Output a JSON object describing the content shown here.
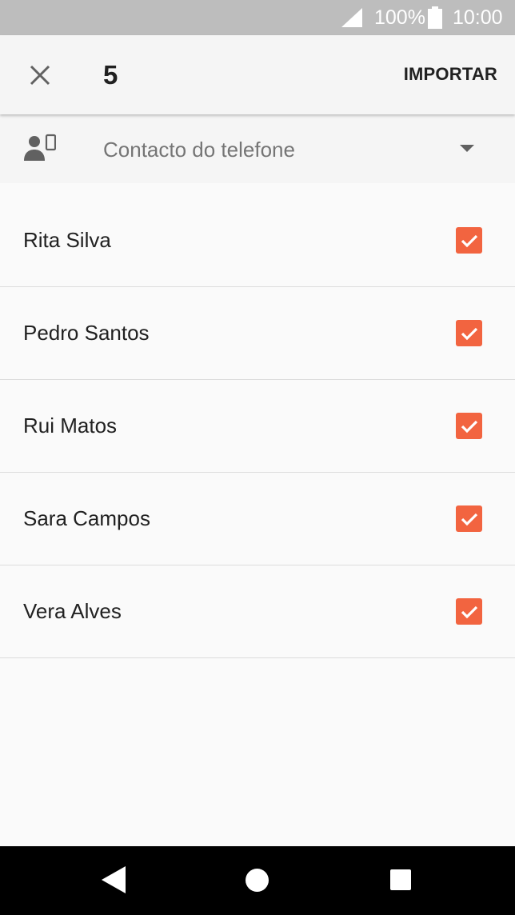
{
  "status_bar": {
    "battery_percent": "100%",
    "time": "10:00",
    "icons": [
      "signal-icon",
      "battery-icon"
    ]
  },
  "header": {
    "selected_count": "5",
    "import_label": "IMPORTAR",
    "close_icon": "close-icon"
  },
  "account": {
    "label": "Contacto do telefone",
    "icon": "phone-contact-icon",
    "dropdown_icon": "dropdown-arrow-icon"
  },
  "contacts": [
    {
      "name": "Rita Silva",
      "checked": true
    },
    {
      "name": "Pedro Santos",
      "checked": true
    },
    {
      "name": "Rui Matos",
      "checked": true
    },
    {
      "name": "Sara Campos",
      "checked": true
    },
    {
      "name": "Vera Alves",
      "checked": true
    }
  ],
  "nav_bar": {
    "icons": [
      "back-icon",
      "home-icon",
      "recents-icon"
    ]
  },
  "colors": {
    "accent": "#f26440",
    "status_bar": "#bdbdbd",
    "background": "#fafafa"
  }
}
